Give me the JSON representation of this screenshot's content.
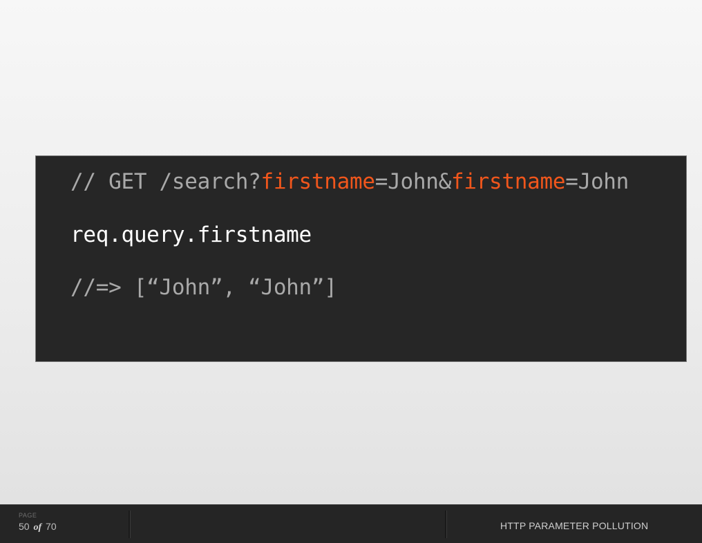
{
  "code": {
    "line1": {
      "prefix": "// GET /search?",
      "param1": "firstname",
      "mid": "=John&",
      "param2": "firstname",
      "suffix": "=John"
    },
    "line2": "req.query.firstname",
    "line3": "//=> [“John”, “John”]"
  },
  "footer": {
    "page_label": "PAGE",
    "page_current": "50",
    "page_of": "of",
    "page_total": "70",
    "title": "HTTP PARAMETER POLLUTION"
  },
  "colors": {
    "highlight": "#f0561c",
    "code_background": "#262626",
    "comment": "#a9a9a9",
    "code_text": "#ffffff"
  }
}
